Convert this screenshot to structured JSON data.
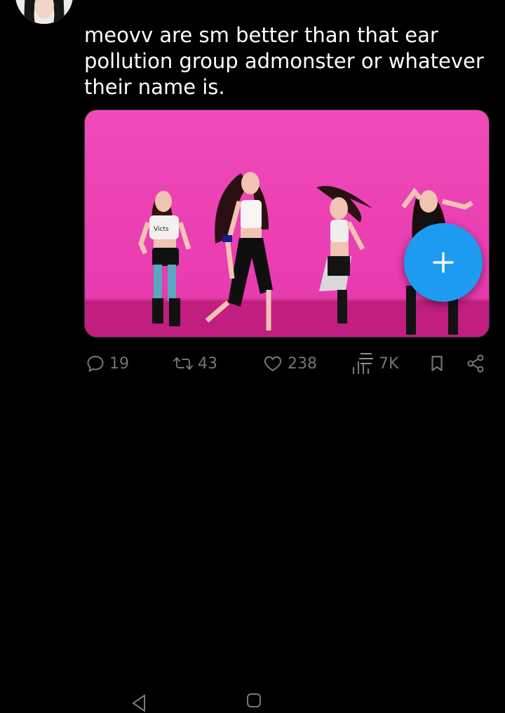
{
  "tweet": {
    "text": "meovv are sm better than that ear pollution group admonster or whatever their name is."
  },
  "media": {
    "type": "video-still",
    "background_color": "#ec3fb6",
    "floor_color": "#c11e7f",
    "shirt_text": "Victs"
  },
  "compose": {
    "icon": "plus-icon",
    "color": "#1d9bf0"
  },
  "actions": {
    "replies": "19",
    "reposts": "43",
    "likes": "238",
    "views": "7K"
  },
  "icons": {
    "reply": "reply-icon",
    "repost": "repost-icon",
    "like": "heart-icon",
    "views": "views-icon",
    "bookmark": "bookmark-icon",
    "share": "share-icon",
    "nav_back": "nav-back-icon",
    "nav_home": "nav-home-icon",
    "nav_recents": "nav-recents-icon"
  }
}
